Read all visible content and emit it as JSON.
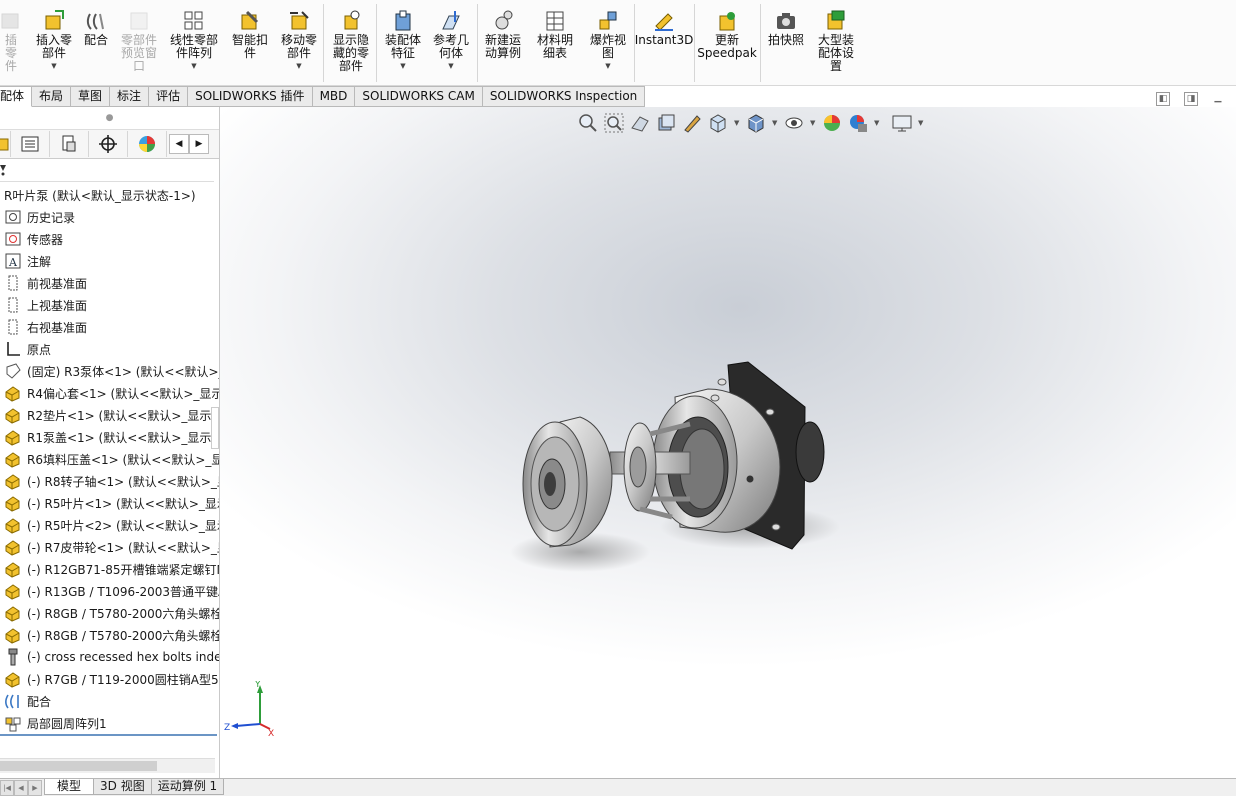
{
  "ribbon": {
    "buttons": [
      {
        "id": "partial-left",
        "label": "插零\n件",
        "dim": true,
        "dropdown": false
      },
      {
        "id": "insert-components",
        "label": "插入零\n部件",
        "dim": false,
        "dropdown": true
      },
      {
        "id": "mate",
        "label": "配合",
        "dim": false,
        "dropdown": false
      },
      {
        "id": "component-preview",
        "label": "零部件\n预览窗\n口",
        "dim": true,
        "dropdown": false
      },
      {
        "id": "linear-pattern",
        "label": "线性零部\n件阵列",
        "dim": false,
        "dropdown": true
      },
      {
        "id": "smart-fasteners",
        "label": "智能扣\n件",
        "dim": false,
        "dropdown": false
      },
      {
        "id": "move-component",
        "label": "移动零\n部件",
        "dim": false,
        "dropdown": true
      },
      {
        "id": "show-hidden",
        "label": "显示隐\n藏的零\n部件",
        "dim": false,
        "dropdown": false
      },
      {
        "id": "assembly-features",
        "label": "装配体\n特征",
        "dim": false,
        "dropdown": true
      },
      {
        "id": "reference-geometry",
        "label": "参考几\n何体",
        "dim": false,
        "dropdown": true
      },
      {
        "id": "new-motion-study",
        "label": "新建运\n动算例",
        "dim": false,
        "dropdown": false
      },
      {
        "id": "bill-of-materials",
        "label": "材料明\n细表",
        "dim": false,
        "dropdown": false
      },
      {
        "id": "exploded-view",
        "label": "爆炸视\n图",
        "dim": false,
        "dropdown": true
      },
      {
        "id": "instant3d",
        "label": "Instant3D",
        "dim": false,
        "dropdown": false
      },
      {
        "id": "update-speedpak",
        "label": "更新\nSpeedpak",
        "dim": false,
        "dropdown": false
      },
      {
        "id": "take-snapshot",
        "label": "拍快照",
        "dim": false,
        "dropdown": false
      },
      {
        "id": "large-assembly",
        "label": "大型装\n配体设\n置",
        "dim": false,
        "dropdown": false
      }
    ]
  },
  "tabs": [
    {
      "label": "配体",
      "active": true
    },
    {
      "label": "布局",
      "active": false
    },
    {
      "label": "草图",
      "active": false
    },
    {
      "label": "标注",
      "active": false
    },
    {
      "label": "评估",
      "active": false
    },
    {
      "label": "SOLIDWORKS 插件",
      "active": false
    },
    {
      "label": "MBD",
      "active": false
    },
    {
      "label": "SOLIDWORKS CAM",
      "active": false
    },
    {
      "label": "SOLIDWORKS Inspection",
      "active": false
    }
  ],
  "tree": {
    "root": "R叶片泵  (默认<默认_显示状态-1>)",
    "items": [
      {
        "label": "历史记录",
        "icon": "history-icon"
      },
      {
        "label": "传感器",
        "icon": "sensor-icon"
      },
      {
        "label": "注解",
        "icon": "annotation-icon"
      },
      {
        "label": "前视基准面",
        "icon": "plane-icon"
      },
      {
        "label": "上视基准面",
        "icon": "plane-icon"
      },
      {
        "label": "右视基准面",
        "icon": "plane-icon"
      },
      {
        "label": "原点",
        "icon": "origin-icon"
      },
      {
        "label": "(固定) R3泵体<1> (默认<<默认>_显",
        "icon": "fixed-part-icon"
      },
      {
        "label": "R4偏心套<1> (默认<<默认>_显示",
        "icon": "part-icon"
      },
      {
        "label": "R2垫片<1> (默认<<默认>_显示状",
        "icon": "part-icon"
      },
      {
        "label": "R1泵盖<1> (默认<<默认>_显示状",
        "icon": "part-icon"
      },
      {
        "label": "R6填料压盖<1> (默认<<默认>_显",
        "icon": "part-icon"
      },
      {
        "label": "(-) R8转子轴<1> (默认<<默认>_显",
        "icon": "part-icon"
      },
      {
        "label": "(-) R5叶片<1> (默认<<默认>_显示",
        "icon": "part-icon"
      },
      {
        "label": "(-) R5叶片<2> (默认<<默认>_显示",
        "icon": "part-icon"
      },
      {
        "label": "(-) R7皮带轮<1> (默认<<默认>_显",
        "icon": "part-icon"
      },
      {
        "label": "(-) R12GB71-85开槽锥端紧定螺钉M",
        "icon": "part-icon"
      },
      {
        "label": "(-) R13GB / T1096-2003普通平键A",
        "icon": "part-icon"
      },
      {
        "label": "(-) R8GB / T5780-2000六角头螺栓",
        "icon": "part-icon"
      },
      {
        "label": "(-) R8GB / T5780-2000六角头螺栓",
        "icon": "part-icon"
      },
      {
        "label": "(-) cross recessed hex bolts inde",
        "icon": "bolt-icon"
      },
      {
        "label": "(-) R7GB / T119-2000圆柱销A型5>",
        "icon": "part-icon"
      },
      {
        "label": "配合",
        "icon": "mates-icon"
      },
      {
        "label": "局部圆周阵列1",
        "icon": "circular-pattern-icon"
      }
    ]
  },
  "bottom_tabs": [
    {
      "label": "模型",
      "active": true
    },
    {
      "label": "3D 视图",
      "active": false
    },
    {
      "label": "运动算例 1",
      "active": false
    }
  ],
  "triad": {
    "x": "X",
    "y": "Y",
    "z": "Z"
  },
  "colors": {
    "accent": "#3b78c4",
    "part": "#f2c22e",
    "background_center": "#c9ced6"
  }
}
